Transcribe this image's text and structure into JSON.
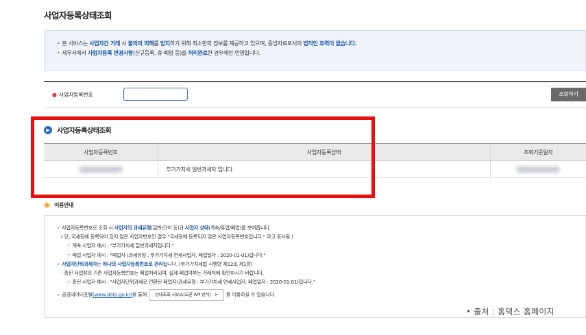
{
  "page": {
    "title": "사업자등록상태조회"
  },
  "notice": {
    "line1": [
      {
        "text": "본 서비스는 ",
        "hl": false
      },
      {
        "text": "사업자간 거래",
        "hl": true
      },
      {
        "text": " 시 ",
        "hl": false
      },
      {
        "text": "불의의 피해",
        "hl": true
      },
      {
        "text": "를 ",
        "hl": false
      },
      {
        "text": "방지",
        "hl": true
      },
      {
        "text": "하기 위해 최소한의 정보를 제공하고 있으며, 증빙자료로서의 ",
        "hl": false
      },
      {
        "text": "법적인 효력이 없습니다.",
        "hl": true
      }
    ],
    "line2": [
      {
        "text": "세무서에서 ",
        "hl": false
      },
      {
        "text": "사업자등록 변경사항",
        "hl": true
      },
      {
        "text": "(신규등록, 휴·폐업 등)을 ",
        "hl": false
      },
      {
        "text": "처리완료",
        "hl": true
      },
      {
        "text": "한 경우에만 반영됩니다.",
        "hl": false
      }
    ]
  },
  "search": {
    "label": "사업자등록번호",
    "input_value": "",
    "button_label": "조회하기"
  },
  "result": {
    "title": "사업자등록상태조회",
    "columns": [
      "사업자등록번호",
      "사업자등록상태",
      "조회기준일자"
    ],
    "row": {
      "status": "부가가치세 일반과세자 입니다."
    }
  },
  "info": {
    "title": "이용안내",
    "l1": [
      {
        "text": "사업자등록번호로 조회 시 ",
        "hl": false
      },
      {
        "text": "사업자의 과세유형",
        "hl": true
      },
      {
        "text": "(일반/간이 등)과 ",
        "hl": false
      },
      {
        "text": "사업자 상태",
        "hl": true
      },
      {
        "text": "(계속/휴업/폐업)를 보여줍니다.",
        "hl": false
      }
    ],
    "l2": "( 단, 국세청에 등록되어 있지 않은 사업자번호인 경우 \"국세청에 등록되지 않은 사업자등록번호입니다.\" 라고 표시됨 )",
    "l3": "☞ 계속 사업자 예시 : \"부가가치세 일반과세자입니다.\"",
    "l4": "☞ 폐업 사업자 예시 : \"폐업자 (과세유형 : 부가가치세 면세사업자, 폐업일자 : 2020-01-01)입니다.\"",
    "l5": [
      {
        "text": "사업자단위과세자",
        "hl": true
      },
      {
        "text": "는 ",
        "hl": false
      },
      {
        "text": "하나의 사업자등록번호로 관리",
        "hl": true
      },
      {
        "text": "됩니다. (부가가치세법 시행령 제12조 제1항)",
        "hl": false
      }
    ],
    "l6": "- 종된 사업장의 기존 사업자등록번호는 폐업처리되며, 실제 폐업여부는 거래처에 확인하시기 바랍니다.",
    "l7": "☞ 종된 사업자 예시 : \"사업자단위과세로 전환된 폐업자(과세유형 : 부가가치세 면세사업자, 폐업일자 : 2020-01-01)입니다.\"",
    "l8_pre": "공공데이터포털",
    "l8_link": "(www.data.go.kr)",
    "l8_mid": "을 통해",
    "api_button": "상태조회 서비스(오픈 API 방식)",
    "l8_post": "를 이용하실 수 있습니다."
  },
  "caption": "• 출처 : 홈택스 홈페이지",
  "colors": {
    "accent": "#1f57a6",
    "frame": "#ec0f0f",
    "button": "#6a6a6a"
  }
}
